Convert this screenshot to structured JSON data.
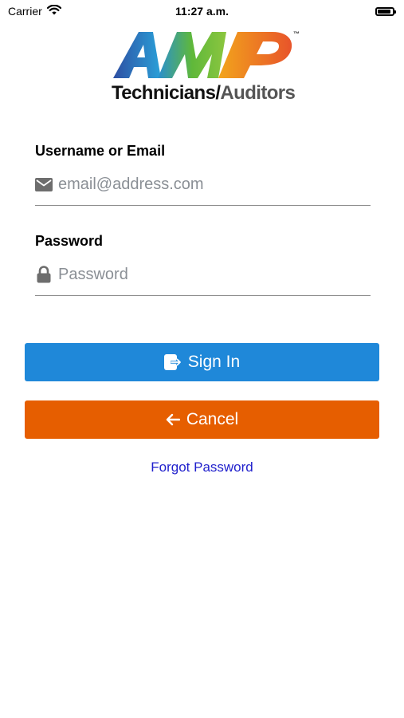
{
  "status_bar": {
    "carrier": "Carrier",
    "time": "11:27 a.m.",
    "battery_level": 0.9
  },
  "logo": {
    "mark_text": "AMP",
    "trademark": "™",
    "tagline_primary": "Technicians/",
    "tagline_secondary": "Auditors"
  },
  "form": {
    "username": {
      "label": "Username or Email",
      "placeholder": "email@address.com",
      "value": "",
      "icon": "envelope-icon"
    },
    "password": {
      "label": "Password",
      "placeholder": "Password",
      "value": "",
      "icon": "lock-icon"
    }
  },
  "actions": {
    "sign_in_label": "Sign In",
    "sign_in_icon": "sign-in-icon",
    "sign_in_color": "#1f88d9",
    "cancel_label": "Cancel",
    "cancel_icon": "arrow-left-icon",
    "cancel_color": "#e65e00",
    "forgot_label": "Forgot Password",
    "link_color": "#2020cc"
  }
}
